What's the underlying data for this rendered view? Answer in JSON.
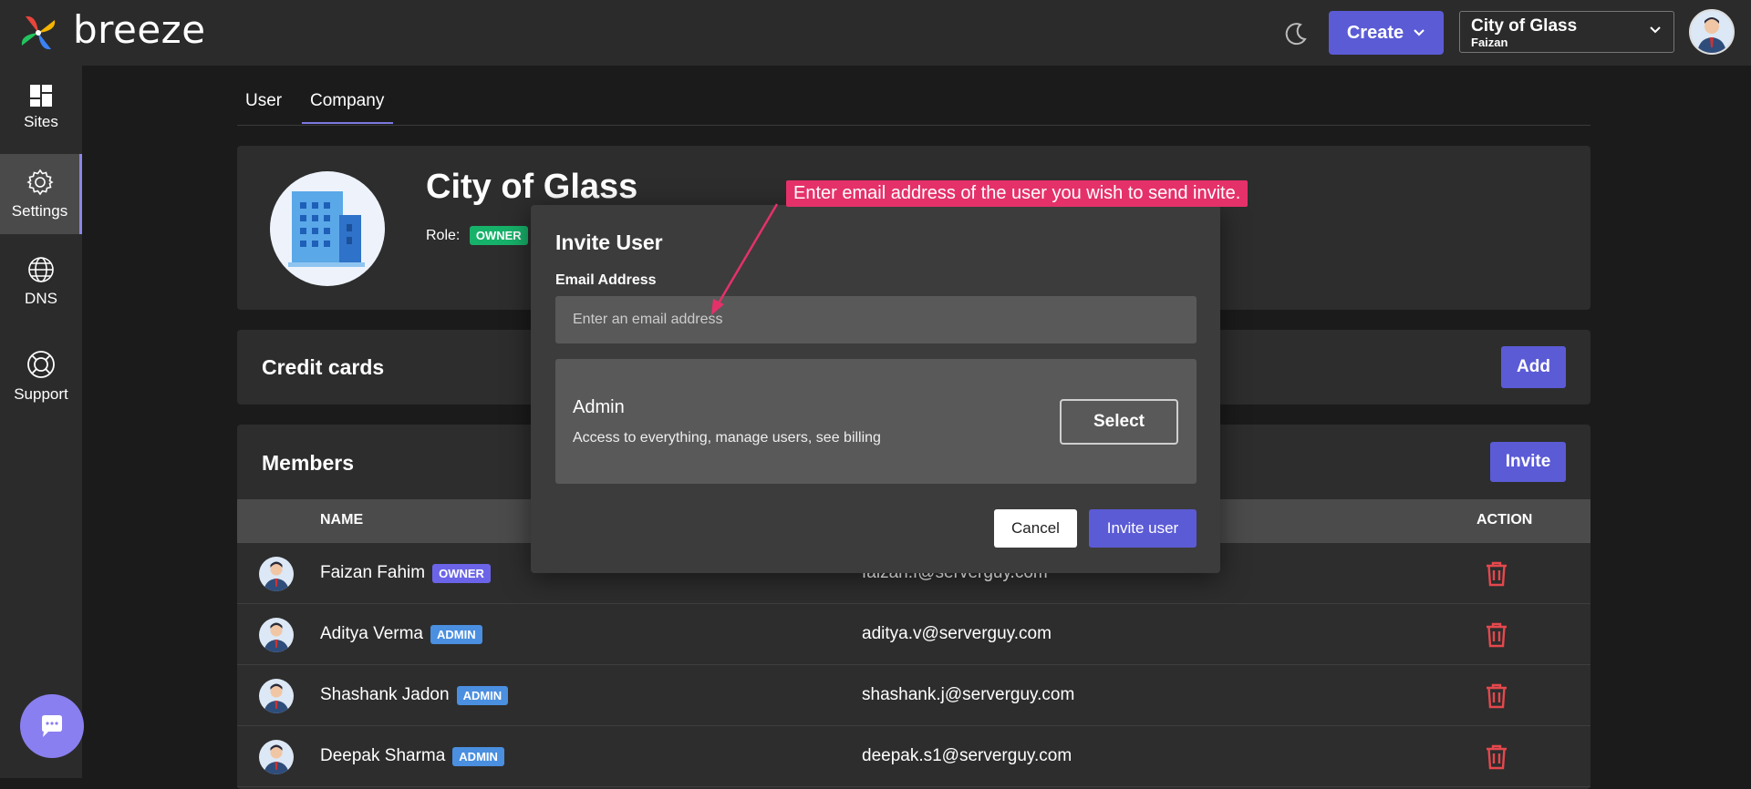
{
  "header": {
    "logo_text": "breeze",
    "create_label": "Create",
    "org_name": "City of Glass",
    "org_user": "Faizan"
  },
  "sidebar": {
    "items": [
      {
        "label": "Sites",
        "icon": "grid-icon"
      },
      {
        "label": "Settings",
        "icon": "gear-icon"
      },
      {
        "label": "DNS",
        "icon": "globe-icon"
      },
      {
        "label": "Support",
        "icon": "lifebuoy-icon"
      }
    ]
  },
  "tabs": [
    {
      "label": "User"
    },
    {
      "label": "Company"
    }
  ],
  "company": {
    "name": "City of Glass",
    "role_label": "Role:",
    "role_badge": "OWNER"
  },
  "credit_cards": {
    "title": "Credit cards",
    "add_label": "Add"
  },
  "members": {
    "title": "Members",
    "invite_label": "Invite",
    "columns": {
      "name": "NAME",
      "action": "ACTION"
    },
    "rows": [
      {
        "name": "Faizan Fahim",
        "badge": "OWNER",
        "email": "faizan.f@serverguy.com"
      },
      {
        "name": "Aditya Verma",
        "badge": "ADMIN",
        "email": "aditya.v@serverguy.com"
      },
      {
        "name": "Shashank Jadon",
        "badge": "ADMIN",
        "email": "shashank.j@serverguy.com"
      },
      {
        "name": "Deepak Sharma",
        "badge": "ADMIN",
        "email": "deepak.s1@serverguy.com"
      }
    ]
  },
  "modal": {
    "title": "Invite User",
    "email_label": "Email Address",
    "email_placeholder": "Enter an email address",
    "email_value": "",
    "role_title": "Admin",
    "role_desc": "Access to everything, manage users, see billing",
    "select_label": "Select",
    "cancel_label": "Cancel",
    "invite_label": "Invite user"
  },
  "annotation": {
    "text": "Enter email address of the user you wish to send invite."
  },
  "colors": {
    "accent": "#5b5bd6",
    "owner_green": "#17b26a",
    "owner_purple": "#6b64e8",
    "admin_blue": "#4a8fe0",
    "delete_red": "#e5484d",
    "annotation": "#e5316a"
  }
}
